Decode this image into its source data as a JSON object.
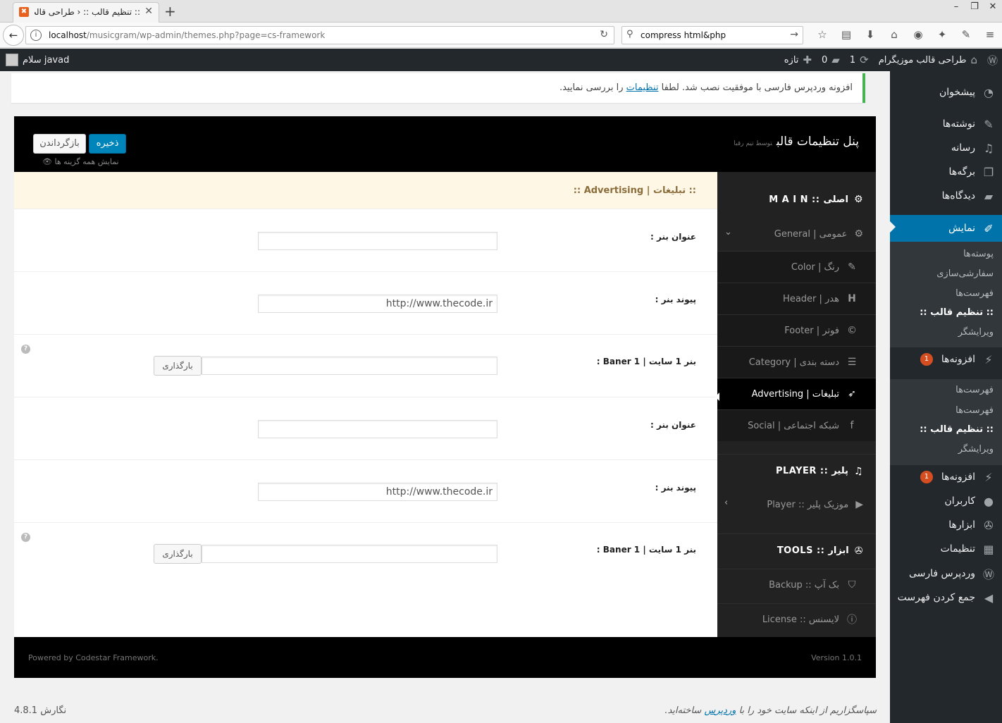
{
  "browser": {
    "tab_title": ":: تنظیم قالب :: ‹ طراحی قالب",
    "url_host": "localhost",
    "url_path": "/musicgram/wp-admin/themes.php?page=cs-framework",
    "search_query": "compress html&php"
  },
  "adminbar": {
    "site_name": "طراحی قالب موزیگرام",
    "updates": "1",
    "comments": "0",
    "new": "تازه",
    "greeting": "سلام javad"
  },
  "sidebar": {
    "items": [
      {
        "label": "پیشخوان",
        "icon": "dashboard-icon"
      },
      {
        "label": "نوشته‌ها",
        "icon": "pin-icon"
      },
      {
        "label": "رسانه",
        "icon": "media-icon"
      },
      {
        "label": "برگه‌ها",
        "icon": "pages-icon"
      },
      {
        "label": "دیدگاه‌ها",
        "icon": "comments-icon"
      },
      {
        "label": "نمایش",
        "icon": "appearance-icon"
      }
    ],
    "appearance_sub": [
      "پوسته‌ها",
      "سفارشی‌سازی",
      "فهرست‌ها",
      ":: تنظیم قالب ::",
      "ویرایشگر"
    ],
    "plugins_label": "افزونه‌ها",
    "plugins_badge": "1",
    "plugins_sub": [
      "فهرست‌ها",
      "فهرست‌ها",
      ":: تنظیم قالب ::",
      "ویرایشگر"
    ],
    "plugins2_label": "افزونه‌ها",
    "plugins2_badge": "1",
    "rest": [
      {
        "label": "کاربران",
        "icon": "users-icon"
      },
      {
        "label": "ابزارها",
        "icon": "tools-icon"
      },
      {
        "label": "تنظیمات",
        "icon": "settings-icon"
      },
      {
        "label": "وردپرس فارسی",
        "icon": "wordpress-icon"
      },
      {
        "label": "جمع کردن فهرست",
        "icon": "collapse-icon"
      }
    ]
  },
  "notice": {
    "before": "افزونه وردپرس فارسی با موفقیت نصب شد. لطفا ",
    "link": "تنظیمات",
    "after": " را بررسی نمایید."
  },
  "panel": {
    "title": "پنل تنظیمات قالب",
    "byline": "توسط تیم رقبا",
    "save": "ذخیره",
    "reset": "بازگرداندن",
    "show_all": "نمایش همه گزینه ها",
    "section_title": ":: تبلیغات | Advertising ::",
    "nav": {
      "main": "M A I N :: اصلی",
      "general": "General | عمومی",
      "color": "Color | رنگ",
      "header": "Header | هدر",
      "footer": "Footer | فوتر",
      "category": "Category | دسته بندی",
      "advertising": "Advertising | تبلیغات",
      "social": "Social | شبکه اجتماعی",
      "player_group": "PLAYER :: پلیر",
      "player": "Player :: موزیک پلیر",
      "tools_group": "TOOLS :: ابزار",
      "backup": "Backup :: بک آپ",
      "license": "License :: لایسنس"
    },
    "fields": [
      {
        "label": "عنوان بنر :",
        "value": ""
      },
      {
        "label": "پیوند بنر :",
        "value": "http://www.thecode.ir"
      },
      {
        "label": "بنر 1 سایت | Baner 1 :",
        "value": "",
        "button": "بارگذاری"
      },
      {
        "label": "عنوان بنر :",
        "value": ""
      },
      {
        "label": "پیوند بنر :",
        "value": "http://www.thecode.ir"
      },
      {
        "label": "بنر 1 سایت | Baner 1 :",
        "value": "",
        "button": "بارگذاری"
      }
    ],
    "powered": "Powered by Codestar Framework.",
    "version": "Version 1.0.1"
  },
  "footer": {
    "thanks_before": "سپاسگزاریم از اینکه سایت خود را با ",
    "thanks_link": "وردپرس",
    "thanks_after": " ساخته‌اید.",
    "version": "نگارش 4.8.1"
  }
}
